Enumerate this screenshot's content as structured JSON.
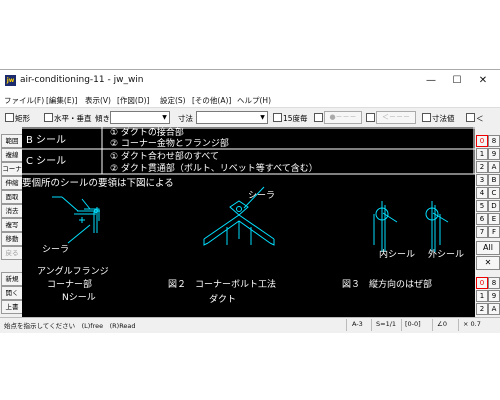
{
  "window": {
    "title": "air-conditioning-11 - jw_win",
    "icon_text": "jw",
    "controls": [
      "—",
      "☐",
      "✕"
    ]
  },
  "menu": [
    "ファイル(F)",
    "[編集(E)]",
    "表示(V)",
    "[作図(D)]",
    "設定(S)",
    "[その他(A)]",
    "ヘルプ(H)"
  ],
  "toolbar": {
    "rect_label": "矩形",
    "horizvert_label": "水平・垂直",
    "slope_label": "傾き",
    "dim_label": "寸法",
    "degree_label": "15度毎",
    "dots_button": "●－－－",
    "arrow_button": "＜－－－",
    "dimval_label": "寸法値",
    "lt_label": "＜"
  },
  "left_tools": [
    "範囲",
    "複線",
    "コーナー",
    "伸縮",
    "面取",
    "消去",
    "複写",
    "移動",
    "戻る",
    "新規",
    "開く",
    "上書"
  ],
  "right_tools": {
    "rows": [
      [
        "0",
        "8"
      ],
      [
        "1",
        "9"
      ],
      [
        "2",
        "A"
      ],
      [
        "3",
        "B"
      ],
      [
        "4",
        "C"
      ],
      [
        "5",
        "D"
      ],
      [
        "6",
        "E"
      ],
      [
        "7",
        "F"
      ]
    ],
    "all_label": "All",
    "x_label": "✕",
    "bottom_rows": [
      [
        "0",
        "8"
      ],
      [
        "1",
        "9"
      ],
      [
        "2",
        "A"
      ]
    ]
  },
  "drawing": {
    "row_b_label": "B シール",
    "row_b_item1": "① ダクトの接合部",
    "row_b_item2": "② コーナー金物とフランジ部",
    "row_c_label": "C シール",
    "row_c_item1": "① ダクト合わせ部のすべて",
    "row_c_item2": "② ダクト貫通部（ボルト、リベット等すべて含む）",
    "heading": "要個所のシールの要領は下図による",
    "sealer1": "シーラ",
    "angle_flange": "アングルフランジ",
    "corner_part": "コーナー部",
    "n_seal": "Nシール",
    "sealer2": "シーラ",
    "fig2": "図２　コーナーボルト工法",
    "duct": "ダクト",
    "inner_seal": "内シール",
    "outer_seal": "外シール",
    "fig3": "図３　縦方向のはぜ部"
  },
  "status": {
    "prompt": "始点を指示してください　(L)free　(R)Read",
    "paper": "A-3",
    "scale": "S=1/1",
    "layer": "[0-0]",
    "angle": "∠0",
    "zoom": "× 0.7"
  },
  "colors": {
    "canvas_bg": "#000000",
    "drawing_text": "#ffffff",
    "drawing_lines": "#00e0ff",
    "table_lines": "#ffffff"
  }
}
